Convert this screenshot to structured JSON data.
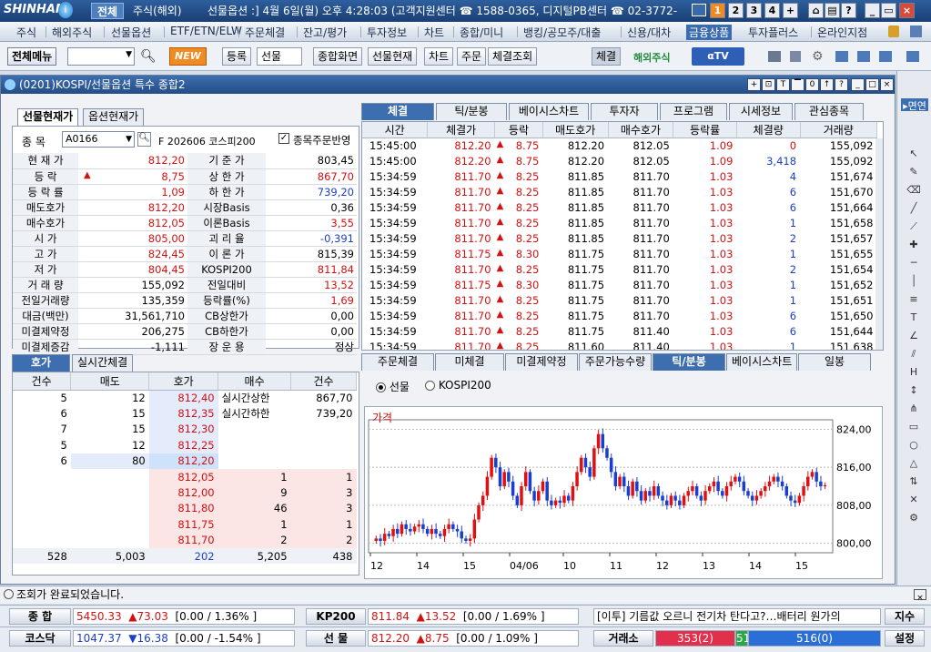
{
  "top": {
    "logo": "SHINHAN",
    "tab_all": "전체",
    "tab_overseas": "주식(해외)",
    "info": "선물옵션 :] 4월 6일(월) 오후 4:28:03 (고객지원센터 ☎ 1588-0365, 디지털PB센터 ☎ 02-3772-",
    "screens": [
      "1",
      "2",
      "3",
      "4",
      "+"
    ]
  },
  "menu": [
    "주식",
    "해외주식",
    "선물옵션",
    "ETF/ETN/ELW",
    "주문체결",
    "잔고/평가",
    "투자정보",
    "차트",
    "종합/미니",
    "뱅킹/공모주/대출",
    "신용/대차",
    "금융상품",
    "투자플러스",
    "온라인지점"
  ],
  "toolbar": {
    "menu_label": "전체메뉴",
    "new_label": "NEW",
    "buttons": [
      "등록",
      "선물",
      "종합화면",
      "선물현재",
      "차트",
      "주문",
      "체결조회",
      "체결"
    ],
    "overseas_label": "해외주식",
    "tv_label": "αTV"
  },
  "window": {
    "title": "(0201)KOSPI/선물옵션 특수 종합2",
    "code": "A0166",
    "product": "F 202606 코스피200",
    "checkbox_label": "종목주문반영",
    "code_label": "종 목"
  },
  "left_tabs": [
    "선물현재가",
    "옵션현재가"
  ],
  "quote": [
    [
      "현 재 가",
      "812,20",
      "",
      "기 준 가",
      "803,45"
    ],
    [
      "등 락",
      "8,75",
      "up",
      "상 한 가",
      "867,70"
    ],
    [
      "등 락 률",
      "1,09",
      "",
      "하 한 가",
      "739,20"
    ],
    [
      "매도호가",
      "812,20",
      "",
      "시장Basis",
      "0,36"
    ],
    [
      "매수호가",
      "812,05",
      "",
      "이론Basis",
      "3,55"
    ],
    [
      "시 가",
      "805,00",
      "",
      "괴 리 율",
      "-0,391"
    ],
    [
      "고 가",
      "824,45",
      "",
      "이 론 가",
      "815,39"
    ],
    [
      "저 가",
      "804,45",
      "",
      "KOSPI200",
      "811,84"
    ],
    [
      "거 래 량",
      "155,092",
      "",
      "전일대비",
      "13,52"
    ],
    [
      "전일거래량",
      "135,359",
      "",
      "등락률(%)",
      "1,69"
    ],
    [
      "대금(백만)",
      "31,561,710",
      "",
      "CB상한가",
      "0,00"
    ],
    [
      "미결제약정",
      "206,275",
      "",
      "CB하한가",
      "0,00"
    ],
    [
      "미결제증감",
      "-1,111",
      "",
      "장 운 용",
      "정상"
    ]
  ],
  "tick_tabs": [
    "체결",
    "틱/분봉",
    "베이시스차트",
    "투자자",
    "프로그램",
    "시세정보",
    "관심종목"
  ],
  "tick_headers": [
    "시간",
    "체결가",
    "등락",
    "매도호가",
    "매수호가",
    "등락률",
    "체결량",
    "거래량"
  ],
  "ticks": [
    [
      "15:45:00",
      "812.20",
      "8.75",
      "812.20",
      "812.05",
      "1.09",
      "0",
      "155,092"
    ],
    [
      "15:45:00",
      "812.20",
      "8.75",
      "812.20",
      "812.05",
      "1.09",
      "3,418",
      "155,092"
    ],
    [
      "15:34:59",
      "811.70",
      "8.25",
      "811.85",
      "811.70",
      "1.03",
      "4",
      "151,674"
    ],
    [
      "15:34:59",
      "811.70",
      "8.25",
      "811.85",
      "811.70",
      "1.03",
      "6",
      "151,670"
    ],
    [
      "15:34:59",
      "811.70",
      "8.25",
      "811.85",
      "811.70",
      "1.03",
      "6",
      "151,664"
    ],
    [
      "15:34:59",
      "811.70",
      "8.25",
      "811.85",
      "811.70",
      "1.03",
      "1",
      "151,658"
    ],
    [
      "15:34:59",
      "811.70",
      "8.25",
      "811.85",
      "811.70",
      "1.03",
      "2",
      "151,657"
    ],
    [
      "15:34:59",
      "811.75",
      "8.30",
      "811.75",
      "811.70",
      "1.03",
      "1",
      "151,655"
    ],
    [
      "15:34:59",
      "811.70",
      "8.25",
      "811.75",
      "811.70",
      "1.03",
      "2",
      "151,654"
    ],
    [
      "15:34:59",
      "811.75",
      "8.30",
      "811.75",
      "811.70",
      "1.03",
      "1",
      "151,652"
    ],
    [
      "15:34:59",
      "811.70",
      "8.25",
      "811.75",
      "811.70",
      "1.03",
      "1",
      "151,651"
    ],
    [
      "15:34:59",
      "811.70",
      "8.25",
      "811.75",
      "811.70",
      "1.03",
      "6",
      "151,650"
    ],
    [
      "15:34:59",
      "811.70",
      "8.25",
      "811.75",
      "811.40",
      "1.03",
      "6",
      "151,644"
    ],
    [
      "15:34:59",
      "811.70",
      "8.25",
      "811.60",
      "811.40",
      "1.03",
      "1",
      "151,638"
    ]
  ],
  "ob_tabs": [
    "호가",
    "실시간체결"
  ],
  "ob_headers": [
    "건수",
    "매도",
    "호가",
    "매수",
    "건수"
  ],
  "ob_asks": [
    [
      "5",
      "12",
      "812,40"
    ],
    [
      "6",
      "15",
      "812,35"
    ],
    [
      "7",
      "15",
      "812,30"
    ],
    [
      "5",
      "12",
      "812,25"
    ],
    [
      "6",
      "80",
      "812,20"
    ]
  ],
  "ob_bids": [
    [
      "812,05",
      "1",
      "1"
    ],
    [
      "812,00",
      "9",
      "3"
    ],
    [
      "811,80",
      "46",
      "3"
    ],
    [
      "811,75",
      "1",
      "1"
    ],
    [
      "811,70",
      "2",
      "2"
    ]
  ],
  "ob_limits": [
    [
      "실시간상한",
      "867,70"
    ],
    [
      "실시간하한",
      "739,20"
    ]
  ],
  "ob_totals": [
    "528",
    "5,003",
    "202",
    "5,205",
    "438"
  ],
  "chart_tabs": [
    "주문체결",
    "미체결",
    "미결제약정",
    "주문가능수량",
    "틱/분봉",
    "베이시스차트",
    "일봉"
  ],
  "chart_radios": [
    "선물",
    "KOSPI200"
  ],
  "chart_buttons": [
    "Tick",
    "1분",
    "5분",
    "60분",
    "일별",
    "편집"
  ],
  "chart_data": {
    "type": "candlestick",
    "title": "가격",
    "ylim": [
      798,
      826
    ],
    "yticks": [
      "824,00",
      "816,00",
      "808,00",
      "800,00"
    ],
    "xticks": [
      "12",
      "14",
      "15",
      "04/06",
      "10",
      "11",
      "12",
      "13",
      "14",
      "15"
    ],
    "closes": [
      801,
      800.5,
      802,
      801.5,
      803,
      802,
      804,
      803,
      802.5,
      803.5,
      804,
      803,
      802,
      803,
      802,
      801.5,
      803,
      804,
      803,
      802.5,
      801,
      800.5,
      801,
      805,
      808,
      810,
      814,
      818,
      816,
      812,
      815,
      813,
      810,
      808,
      812,
      815,
      811,
      809,
      811,
      813,
      809,
      808,
      809,
      808.5,
      810,
      809,
      812,
      815,
      818,
      816,
      814,
      820,
      823,
      820,
      818,
      815,
      812,
      814,
      812,
      810,
      813,
      811,
      809,
      811,
      810,
      812,
      810,
      809,
      808,
      810,
      809,
      808,
      810,
      811,
      812,
      810,
      809,
      811,
      812,
      813,
      811,
      810,
      812,
      813,
      814,
      813,
      811,
      810,
      809,
      810,
      811,
      812,
      813,
      814,
      813,
      812,
      810,
      809,
      808.5,
      810,
      812,
      814,
      815,
      813,
      812,
      812.2
    ]
  },
  "status": "조회가 완료되었습니다.",
  "bottom1": {
    "label1": "종 합",
    "v1": "5450.33",
    "c1": "73.03",
    "p1": "[0.00 / 1.36% ]",
    "label2": "KP200",
    "v2": "811.84",
    "c2": "13.52",
    "p2": "[0.00 / 1.69% ]",
    "news": "[이투] 기름값 오르니 전기차 탄다고?…배터리 원가의",
    "btn": "지수"
  },
  "bottom2": {
    "label1": "코스닥",
    "v1": "1047.37",
    "c1": "16.38",
    "p1": "[0.00 / -1.54% ]",
    "label2": "선 물",
    "v2": "812.20",
    "c2": "8.75",
    "p2": "[0.00 / 1.09% ]",
    "label3": "거래소",
    "red": "353(2)",
    "green": "51",
    "blue": "516(0)",
    "btn": "설정"
  },
  "colors": {
    "up": "#d31111",
    "down": "#1c3fc8",
    "accent": "#3b6cb0"
  }
}
